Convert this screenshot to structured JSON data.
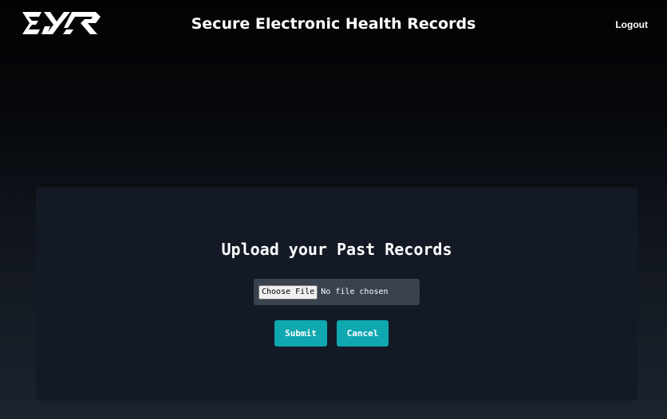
{
  "header": {
    "title": "Secure Electronic Health Records",
    "logout_label": "Logout",
    "logo_icon": "ehr-logo-icon"
  },
  "upload": {
    "heading": "Upload your Past Records",
    "choose_file_label": "Choose File",
    "file_status": "No file chosen",
    "submit_label": "Submit",
    "cancel_label": "Cancel"
  },
  "colors": {
    "accent": "#0fa7b0",
    "card_background": "#131a26",
    "file_box_background": "#3a4250",
    "text": "#ffffff"
  }
}
